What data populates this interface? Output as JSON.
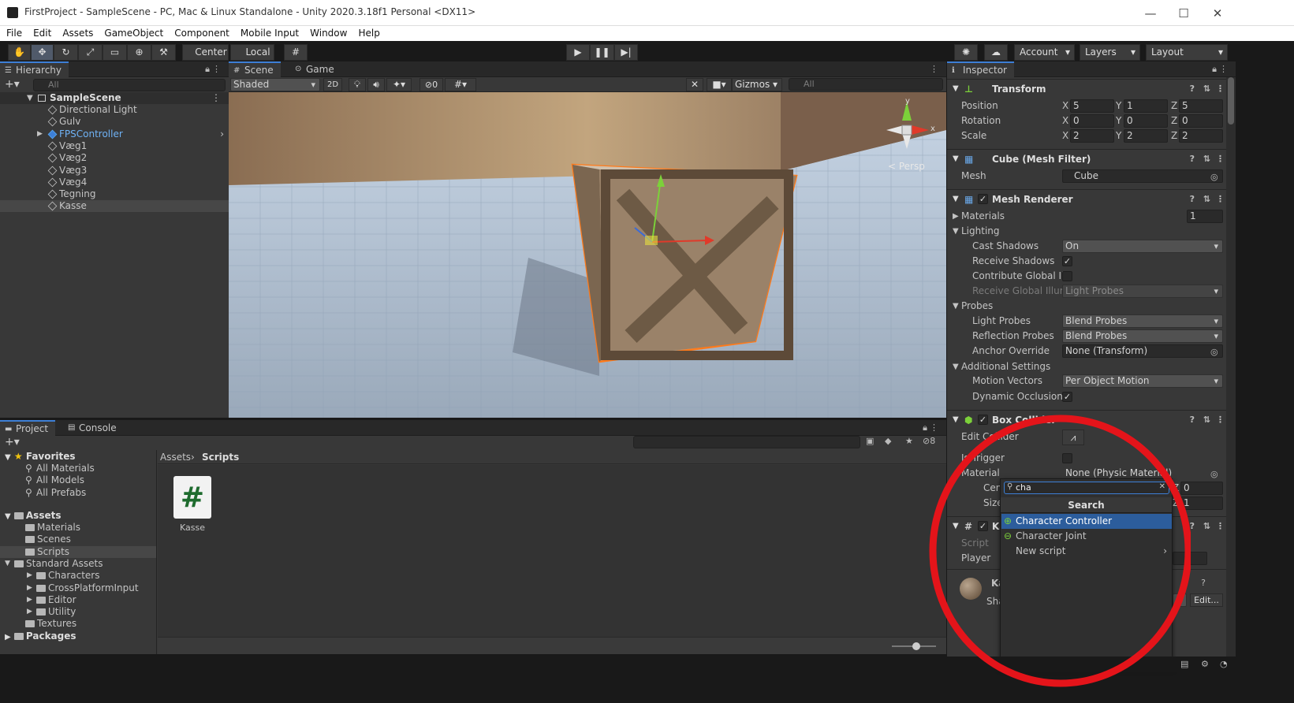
{
  "window": {
    "title": "FirstProject - SampleScene - PC, Mac & Linux Standalone - Unity 2020.3.18f1 Personal <DX11>",
    "minimize": "—",
    "maximize": "☐",
    "close": "✕"
  },
  "menu": [
    "File",
    "Edit",
    "Assets",
    "GameObject",
    "Component",
    "Mobile Input",
    "Window",
    "Help"
  ],
  "toolbar": {
    "pivot": "Center",
    "space": "Local",
    "account": "Account",
    "layers": "Layers",
    "layout": "Layout"
  },
  "hierarchy": {
    "tab": "Hierarchy",
    "search_placeholder": "All",
    "scene": "SampleScene",
    "items": [
      {
        "label": "Directional Light",
        "prefab": false
      },
      {
        "label": "Gulv",
        "prefab": false
      },
      {
        "label": "FPSController",
        "prefab": true
      },
      {
        "label": "Væg1",
        "prefab": false
      },
      {
        "label": "Væg2",
        "prefab": false
      },
      {
        "label": "Væg3",
        "prefab": false
      },
      {
        "label": "Væg4",
        "prefab": false
      },
      {
        "label": "Tegning",
        "prefab": false
      },
      {
        "label": "Kasse",
        "prefab": false
      }
    ]
  },
  "scene_view": {
    "tabs": [
      "Scene",
      "Game"
    ],
    "shading": "Shaded",
    "mode_2d": "2D",
    "hidden_count": "0",
    "gizmos": "Gizmos",
    "search_placeholder": "All",
    "persp": "< Persp",
    "axis_x": "x",
    "axis_y": "y"
  },
  "project": {
    "tabs": [
      "Project",
      "Console"
    ],
    "favorites": {
      "label": "Favorites",
      "items": [
        "All Materials",
        "All Models",
        "All Prefabs"
      ]
    },
    "assets": {
      "label": "Assets",
      "items": [
        "Materials",
        "Scenes",
        "Scripts",
        "Standard Assets",
        "Characters",
        "CrossPlatformInput",
        "Editor",
        "Utility",
        "Textures"
      ]
    },
    "packages": "Packages",
    "breadcrumb": [
      "Assets",
      "Scripts"
    ],
    "hidden_count": "8",
    "file": {
      "name": "Kasse",
      "glyph": "#"
    }
  },
  "inspector": {
    "tab": "Inspector",
    "transform": {
      "title": "Transform",
      "position": {
        "label": "Position",
        "x": "5",
        "y": "1",
        "z": "5"
      },
      "rotation": {
        "label": "Rotation",
        "x": "0",
        "y": "0",
        "z": "0"
      },
      "scale": {
        "label": "Scale",
        "x": "2",
        "y": "2",
        "z": "2"
      }
    },
    "mesh_filter": {
      "title": "Cube (Mesh Filter)",
      "mesh_label": "Mesh",
      "mesh_value": "Cube"
    },
    "mesh_renderer": {
      "title": "Mesh Renderer",
      "materials_label": "Materials",
      "materials_count": "1",
      "lighting": "Lighting",
      "cast_shadows": {
        "label": "Cast Shadows",
        "value": "On"
      },
      "receive_shadows": {
        "label": "Receive Shadows",
        "checked": true
      },
      "contribute_gi": {
        "label": "Contribute Global Illu",
        "checked": false
      },
      "receive_gi": {
        "label": "Receive Global Illumi",
        "value": "Light Probes"
      },
      "probes": "Probes",
      "light_probes": {
        "label": "Light Probes",
        "value": "Blend Probes"
      },
      "reflection_probes": {
        "label": "Reflection Probes",
        "value": "Blend Probes"
      },
      "anchor_override": {
        "label": "Anchor Override",
        "value": "None (Transform)"
      },
      "additional": "Additional Settings",
      "motion_vectors": {
        "label": "Motion Vectors",
        "value": "Per Object Motion"
      },
      "dynamic_occlusion": {
        "label": "Dynamic Occlusion",
        "checked": true
      }
    },
    "box_collider": {
      "title": "Box Collider",
      "edit_collider": "Edit Collider",
      "is_trigger": "Is Trigger",
      "material_label": "Material",
      "material_value": "None (Physic Material)",
      "center": "Center",
      "center_z": "0",
      "size": "Size",
      "size_z": "1"
    },
    "script_comp": {
      "title_partial": "Ka",
      "script_label": "Script",
      "player_label": "Player"
    },
    "material": {
      "name_partial": "Ka",
      "shader_partial": "Sha",
      "edit": "Edit..."
    }
  },
  "add_component_popup": {
    "search_value": "cha",
    "header": "Search",
    "items": [
      "Character Controller",
      "Character Joint",
      "New script"
    ],
    "selected_index": 0
  },
  "annotation_color": "#e4141a",
  "accent": "#3d7fd6"
}
